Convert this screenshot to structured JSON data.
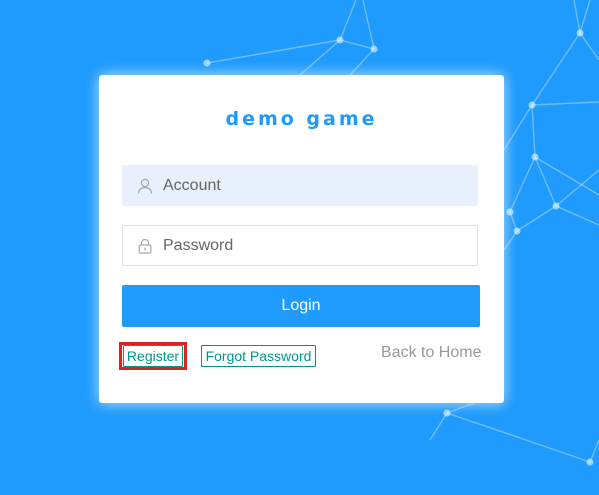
{
  "colors": {
    "background": "#1e9bfc",
    "accent": "#1e9bfc",
    "link": "#009688",
    "highlight": "#e02222"
  },
  "card": {
    "title": "demo game"
  },
  "form": {
    "account_placeholder": "Account",
    "password_placeholder": "Password",
    "account_icon": "user-icon",
    "password_icon": "lock-icon",
    "login_label": "Login"
  },
  "links": {
    "register_label": "Register",
    "forgot_label": "Forgot Password",
    "back_home_label": "Back to Home"
  }
}
